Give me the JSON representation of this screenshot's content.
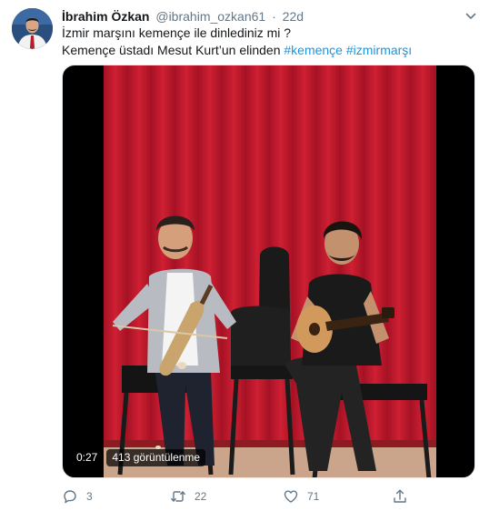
{
  "tweet": {
    "author_name": "İbrahim Özkan",
    "handle": "@ibrahim_ozkan61",
    "separator": "·",
    "time": "22d",
    "text_line1": "İzmir marşını kemençe ile dinlediniz mi ?",
    "text_line2_prefix": "Kemençe üstadı Mesut Kurt’un elinden",
    "hashtags": [
      "#kemençe",
      "#izmirmarşı"
    ]
  },
  "video": {
    "duration": "0:27",
    "views": "413 görüntülenme"
  },
  "actions": {
    "reply_count": "3",
    "retweet_count": "22",
    "like_count": "71"
  },
  "icons": {
    "more": "chevron-down-icon",
    "reply": "reply-icon",
    "retweet": "retweet-icon",
    "like": "heart-icon",
    "share": "share-icon"
  },
  "colors": {
    "link": "#1b95e0",
    "secondary_text": "#657786",
    "curtain": "#c61a2e"
  }
}
